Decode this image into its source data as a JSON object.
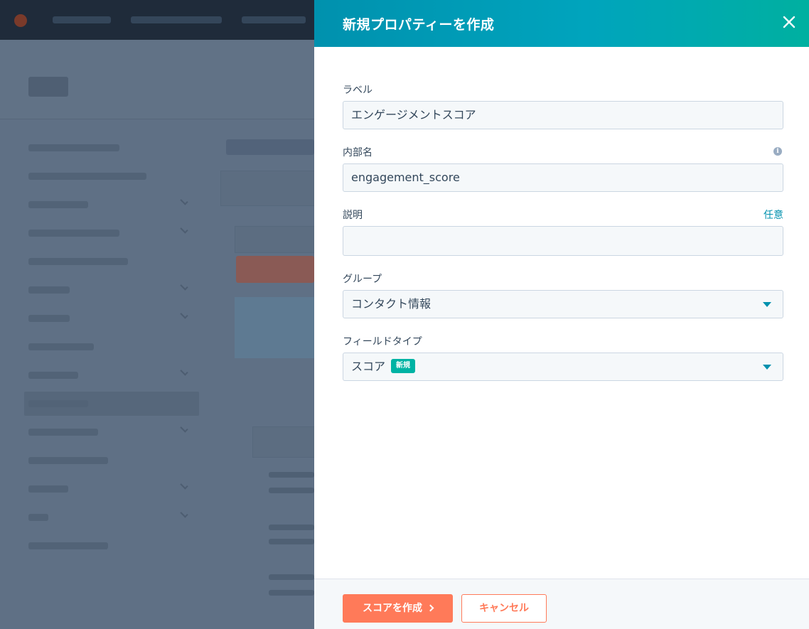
{
  "panel": {
    "title": "新規プロパティーを作成",
    "close_icon": "close-icon"
  },
  "form": {
    "label": {
      "label": "ラベル",
      "value": "エンゲージメントスコア"
    },
    "internal_name": {
      "label": "内部名",
      "value": "engagement_score",
      "info_icon": "info-icon"
    },
    "description": {
      "label": "説明",
      "optional": "任意",
      "value": ""
    },
    "group": {
      "label": "グループ",
      "value": "コンタクト情報"
    },
    "field_type": {
      "label": "フィールドタイプ",
      "value": "スコア",
      "badge": "新規"
    }
  },
  "footer": {
    "primary_label": "スコアを作成",
    "cancel_label": "キャンセル"
  },
  "colors": {
    "header_start": "#0091ae",
    "header_end": "#00b0a0",
    "primary": "#ff7a59",
    "accent": "#0091ae"
  }
}
